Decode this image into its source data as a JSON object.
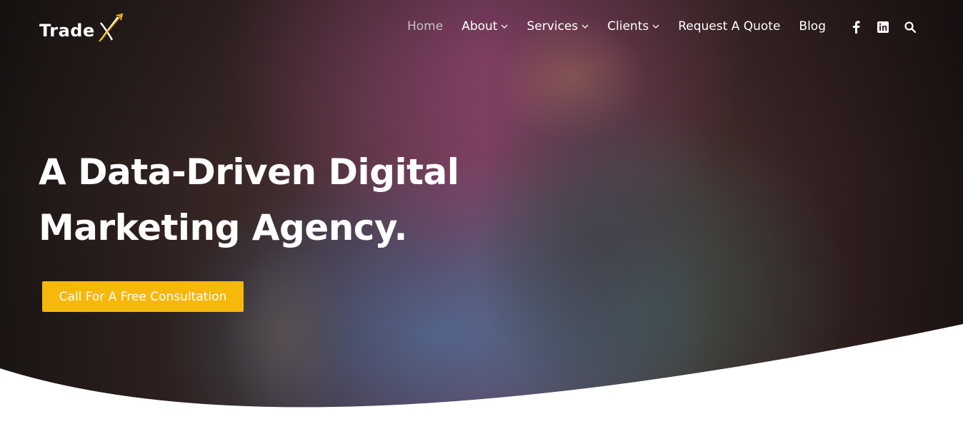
{
  "brand": {
    "name": "Trade",
    "mark": "X"
  },
  "nav": {
    "items": [
      {
        "label": "Home",
        "active": true,
        "dropdown": false
      },
      {
        "label": "About",
        "active": false,
        "dropdown": true
      },
      {
        "label": "Services",
        "active": false,
        "dropdown": true
      },
      {
        "label": "Clients",
        "active": false,
        "dropdown": true
      },
      {
        "label": "Request A Quote",
        "active": false,
        "dropdown": false
      },
      {
        "label": "Blog",
        "active": false,
        "dropdown": false
      }
    ],
    "icons": [
      "facebook-icon",
      "linkedin-icon",
      "search-icon"
    ]
  },
  "hero": {
    "headline_line1": "A Data-Driven Digital",
    "headline_line2": "Marketing Agency.",
    "cta_label": "Call For A Free Consultation"
  },
  "colors": {
    "accent": "#f6b80b",
    "logo_accent": "#f6b80b",
    "nav_text": "#ffffff",
    "nav_active": "#c8c0c4",
    "background": "#ffffff"
  }
}
